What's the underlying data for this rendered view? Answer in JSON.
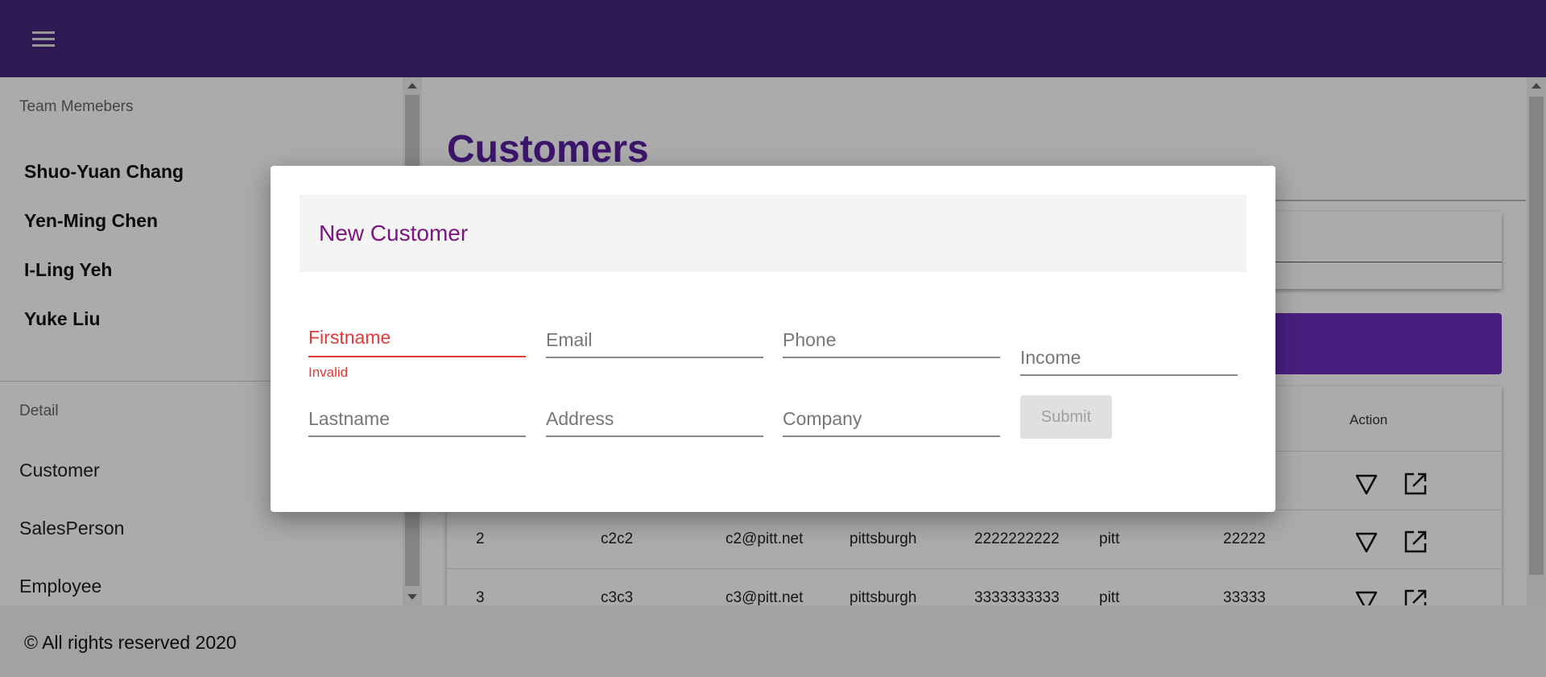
{
  "sidebar": {
    "team_header": "Team Memebers",
    "members": [
      "Shuo-Yuan Chang",
      "Yen-Ming Chen",
      "I-Ling Yeh",
      "Yuke Liu"
    ],
    "detail_header": "Detail",
    "nav": [
      "Customer",
      "SalesPerson",
      "Employee"
    ]
  },
  "main": {
    "title": "Customers",
    "table": {
      "action_header": "Action",
      "rows": [
        [
          "2",
          "c2c2",
          "c2@pitt.net",
          "pittsburgh",
          "2222222222",
          "pitt",
          "22222"
        ],
        [
          "3",
          "c3c3",
          "c3@pitt.net",
          "pittsburgh",
          "3333333333",
          "pitt",
          "33333"
        ]
      ]
    }
  },
  "footer": {
    "text": "© All rights reserved 2020"
  },
  "dialog": {
    "title": "New Customer",
    "fields": {
      "firstname": {
        "label": "Firstname",
        "error": "Invalid"
      },
      "email": {
        "label": "Email"
      },
      "phone": {
        "label": "Phone"
      },
      "income": {
        "label": "Income"
      },
      "lastname": {
        "label": "Lastname"
      },
      "address": {
        "label": "Address"
      },
      "company": {
        "label": "Company"
      }
    },
    "submit_label": "Submit"
  },
  "icons": {
    "menu": "menu-icon",
    "expand": "triangle-down-icon",
    "open": "open-in-new-icon"
  },
  "colors": {
    "appbar": "#46267d",
    "title": "#5a20a0",
    "dialog_title": "#7b1580",
    "error": "#e53935",
    "button": "#6a2fbe"
  }
}
